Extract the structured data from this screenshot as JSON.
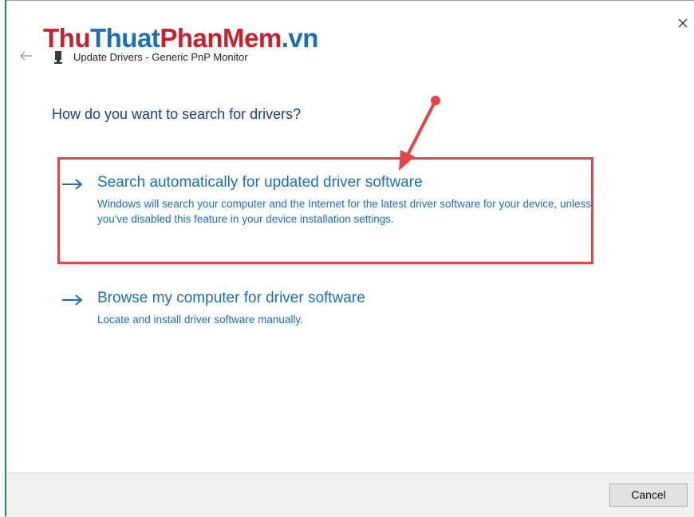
{
  "window": {
    "title": "Update Drivers - Generic PnP Monitor",
    "close_icon": "close-icon",
    "back_icon": "back-arrow-icon",
    "device_icon": "monitor-icon"
  },
  "watermark": {
    "part1": "Thu",
    "part2": "Thuat",
    "part3": "PhanMem",
    "part4": ".vn"
  },
  "main": {
    "heading": "How do you want to search for drivers?",
    "options": [
      {
        "icon": "right-arrow-icon",
        "title": "Search automatically for updated driver software",
        "description": "Windows will search your computer and the Internet for the latest driver software for your device, unless you've disabled this feature in your device installation settings."
      },
      {
        "icon": "right-arrow-icon",
        "title": "Browse my computer for driver software",
        "description": "Locate and install driver software manually."
      }
    ]
  },
  "footer": {
    "cancel_label": "Cancel"
  },
  "colors": {
    "link_blue": "#1d6bc0",
    "heading_blue": "#1a3d8f",
    "highlight_red": "#e24548",
    "footer_bg": "#f0f0f0"
  }
}
